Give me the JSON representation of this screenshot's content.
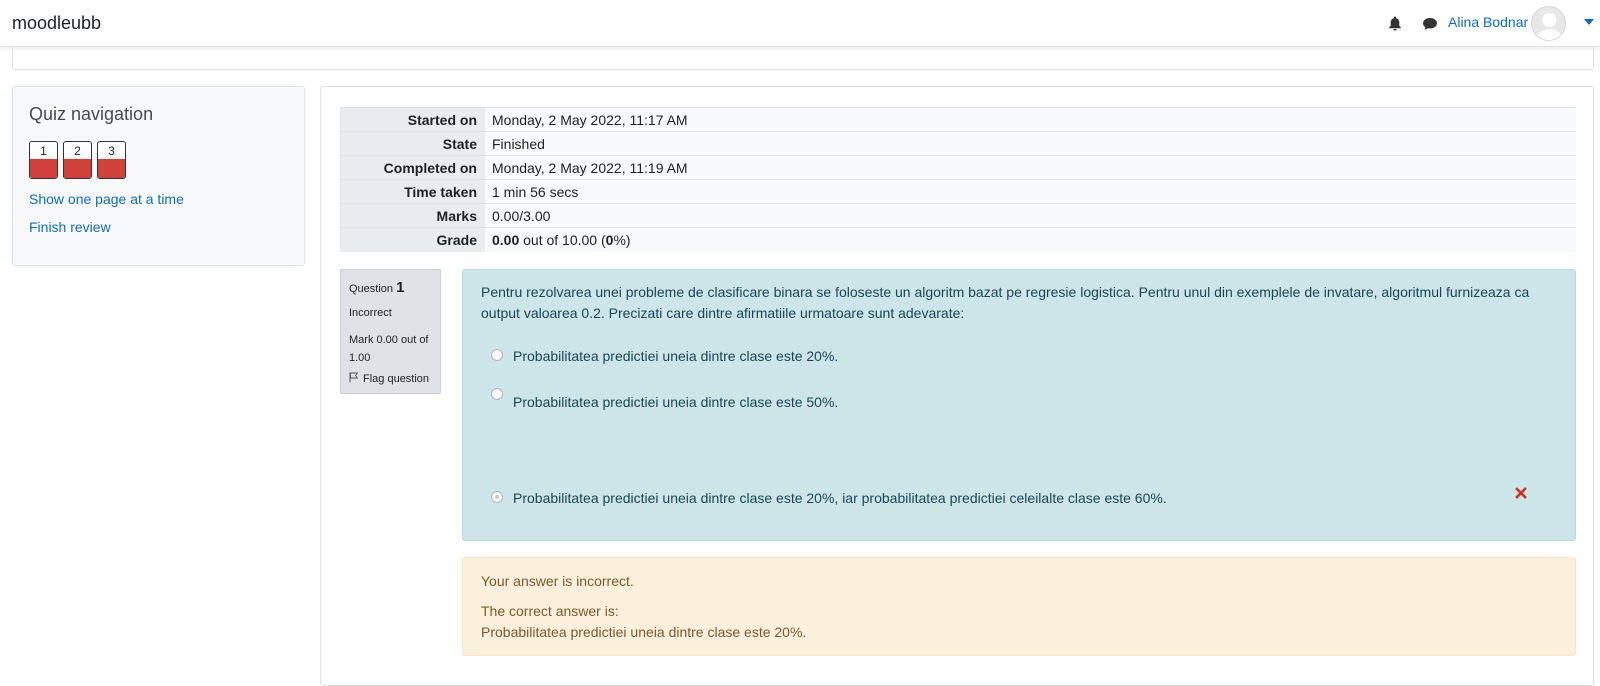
{
  "navbar": {
    "brand": "moodleubb",
    "username": "Alina Bodnar",
    "icons": [
      "bell-icon",
      "chat-icon",
      "avatar",
      "chevron-down-icon"
    ]
  },
  "quiz_nav": {
    "title": "Quiz navigation",
    "buttons": [
      {
        "label": "1",
        "state": "incorrect"
      },
      {
        "label": "2",
        "state": "incorrect"
      },
      {
        "label": "3",
        "state": "incorrect"
      }
    ],
    "links": [
      "Show one page at a time",
      "Finish review"
    ]
  },
  "summary": {
    "rows": [
      {
        "label": "Started on",
        "value": "Monday, 2 May 2022, 11:17 AM"
      },
      {
        "label": "State",
        "value": "Finished"
      },
      {
        "label": "Completed on",
        "value": "Monday, 2 May 2022, 11:19 AM"
      },
      {
        "label": "Time taken",
        "value": "1 min 56 secs"
      },
      {
        "label": "Marks",
        "value": "0.00/3.00"
      }
    ],
    "grade": {
      "label": "Grade",
      "score": "0.00",
      "out_of": "out of 10.00 (",
      "percent": "0",
      "suffix": "%)"
    }
  },
  "question": {
    "label": "Question",
    "number": "1",
    "state": "Incorrect",
    "mark": "Mark 0.00 out of 1.00",
    "flag": "Flag question",
    "text": "Pentru rezolvarea unei probleme de clasificare binara se foloseste un algoritm bazat pe regresie logistica. Pentru unul din exemplele de invatare, algoritmul furnizeaza ca output valoarea 0.2. Precizati care dintre afirmatiile urmatoare sunt adevarate:",
    "answers": [
      {
        "text": "Probabilitatea predictiei uneia dintre clase este 20%.",
        "selected": false
      },
      {
        "text": "Probabilitatea predictiei uneia dintre clase este 50%.",
        "selected": false
      },
      {
        "text": "Probabilitatea predictiei uneia dintre clase este 20%, iar probabilitatea predictiei celeilalte clase este 60%.",
        "selected": true,
        "marked": "incorrect"
      }
    ]
  },
  "outcome": {
    "feedback": "Your answer is incorrect.",
    "correct_label": "The correct answer is:",
    "correct_answer": "Probabilitatea predictiei uneia dintre clase este 20%."
  },
  "colors": {
    "link": "#0f6cbf",
    "incorrect": "#d2403a",
    "formulation_bg": "#cce5e9",
    "outcome_bg": "#fcefdc"
  }
}
